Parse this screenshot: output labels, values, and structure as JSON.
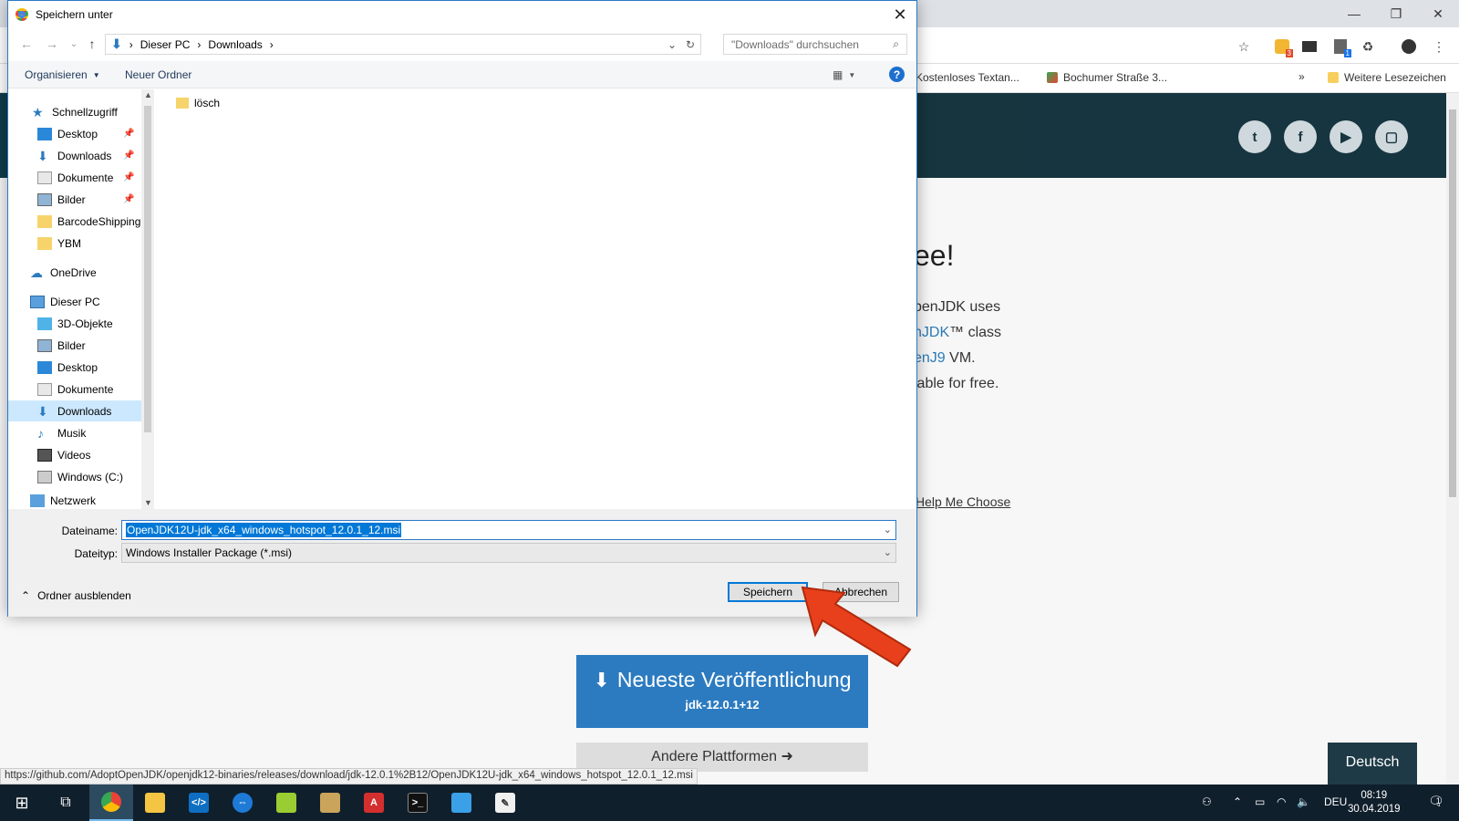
{
  "browser": {
    "bookmarks": [
      "Kostenloses Textan...",
      "Bochumer Straße 3...",
      "Weitere Lesezeichen"
    ],
    "bookmark_more": "»",
    "extension_badge_1": "3",
    "extension_badge_2": "1"
  },
  "site": {
    "hero_title": "ee!",
    "hero_lines": [
      {
        "pre": "",
        "link": "",
        "post": "penJDK uses"
      },
      {
        "pre": "",
        "link": "nJDK",
        "post": "™ class"
      },
      {
        "pre": "",
        "link": "enJ9",
        "post": " VM."
      },
      {
        "pre": "",
        "link": "",
        "post": "lable for free."
      }
    ],
    "help_link": "Help Me Choose",
    "download_label": "Neueste Veröffentlichung",
    "download_version": "jdk-12.0.1+12",
    "other_platforms": "Andere Plattformen",
    "language_button": "Deutsch",
    "status_url": "https://github.com/AdoptOpenJDK/openjdk12-binaries/releases/download/jdk-12.0.1%2B12/OpenJDK12U-jdk_x64_windows_hotspot_12.0.1_12.msi"
  },
  "dialog": {
    "title": "Speichern unter",
    "breadcrumb": [
      "Dieser PC",
      "Downloads"
    ],
    "search_placeholder": "\"Downloads\" durchsuchen",
    "organize": "Organisieren",
    "new_folder": "Neuer Ordner",
    "help": "?",
    "nav": {
      "quick_access": "Schnellzugriff",
      "quick_items": [
        "Desktop",
        "Downloads",
        "Dokumente",
        "Bilder",
        "BarcodeShipping",
        "YBM"
      ],
      "onedrive": "OneDrive",
      "this_pc": "Dieser PC",
      "pc_items": [
        "3D-Objekte",
        "Bilder",
        "Desktop",
        "Dokumente",
        "Downloads",
        "Musik",
        "Videos",
        "Windows (C:)"
      ],
      "network": "Netzwerk"
    },
    "folders": [
      "lösch"
    ],
    "filename_label": "Dateiname:",
    "filename_value": "OpenJDK12U-jdk_x64_windows_hotspot_12.0.1_12.msi",
    "filetype_label": "Dateityp:",
    "filetype_value": "Windows Installer Package (*.msi)",
    "hide_folders": "Ordner ausblenden",
    "save": "Speichern",
    "cancel": "Abbrechen"
  },
  "taskbar": {
    "language": "DEU",
    "time": "08:19",
    "date": "30.04.2019",
    "notification_count": "1"
  },
  "colors": {
    "accent": "#0078d7",
    "download_button": "#2c7bc0",
    "arrow": "#e8401c"
  }
}
